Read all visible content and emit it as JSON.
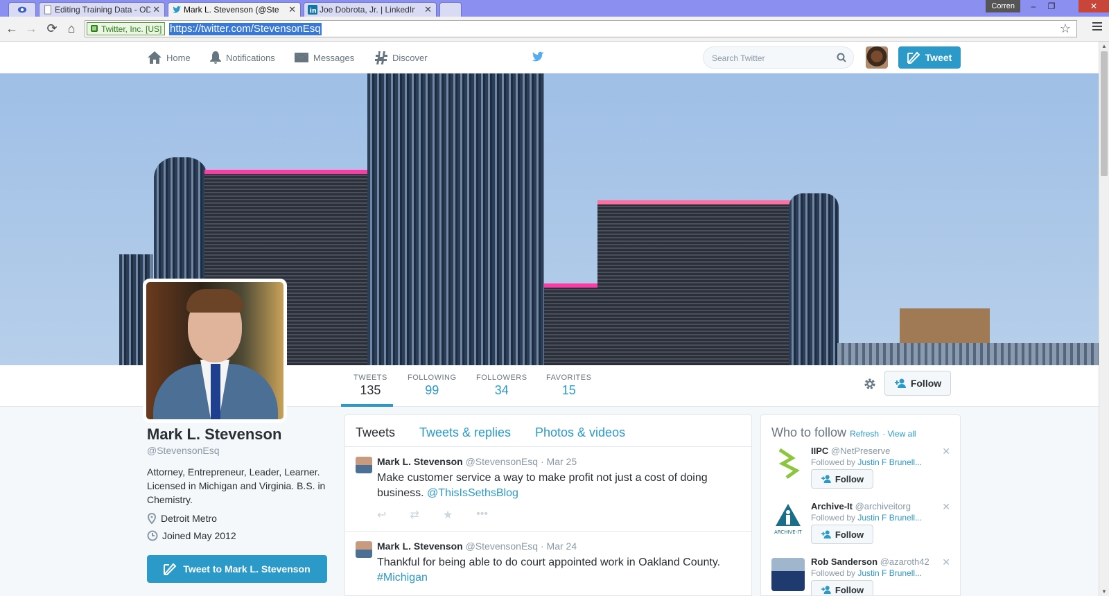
{
  "browser": {
    "tabs": [
      {
        "label": "",
        "icon": "eye-icon"
      },
      {
        "label": "Editing Training Data - OD",
        "icon": "document-icon"
      },
      {
        "label": "Mark L. Stevenson (@Stev",
        "icon": "twitter-icon"
      },
      {
        "label": "Joe Dobrota, Jr. | LinkedIn",
        "icon": "linkedin-icon"
      }
    ],
    "active_tab": 2,
    "user": "Corren",
    "ev_label": "Twitter, Inc. [US]",
    "url": "https://twitter.com/StevensonEsq"
  },
  "nav": {
    "home": "Home",
    "notifications": "Notifications",
    "messages": "Messages",
    "discover": "Discover",
    "search_placeholder": "Search Twitter",
    "tweet_button": "Tweet"
  },
  "stats": {
    "tweets_label": "TWEETS",
    "tweets": "135",
    "following_label": "FOLLOWING",
    "following": "99",
    "followers_label": "FOLLOWERS",
    "followers": "34",
    "favorites_label": "FAVORITES",
    "favorites": "15",
    "follow_button": "Follow"
  },
  "profile": {
    "name": "Mark L. Stevenson",
    "handle": "@StevensonEsq",
    "bio": "Attorney, Entrepreneur, Leader, Learner. Licensed in Michigan and Virginia. B.S. in Chemistry.",
    "location": "Detroit Metro",
    "joined": "Joined May 2012",
    "tweet_to": "Tweet to Mark L. Stevenson"
  },
  "timeline": {
    "tabs": [
      "Tweets",
      "Tweets & replies",
      "Photos & videos"
    ],
    "tweets": [
      {
        "name": "Mark L. Stevenson",
        "handle": "@StevensonEsq",
        "date": "· Mar 25",
        "text": "Make customer service a way to make profit not just a cost of doing business.",
        "link": "@ThisIsSethsBlog"
      },
      {
        "name": "Mark L. Stevenson",
        "handle": "@StevensonEsq",
        "date": "· Mar 24",
        "text": "Thankful for being able to do court appointed work in Oakland County.",
        "link": "#Michigan"
      }
    ]
  },
  "who_to_follow": {
    "title": "Who to follow",
    "refresh": "Refresh",
    "view_all": "View all",
    "followed_by_prefix": "Followed by",
    "follow_label": "Follow",
    "items": [
      {
        "name": "IIPC",
        "handle": "@NetPreserve",
        "followed_by": "Justin F Brunell..."
      },
      {
        "name": "Archive-It",
        "handle": "@archiveitorg",
        "followed_by": "Justin F Brunell..."
      },
      {
        "name": "Rob Sanderson",
        "handle": "@azaroth42",
        "followed_by": "Justin F Brunell..."
      }
    ]
  },
  "colors": {
    "twitter_blue": "#2b9ac8",
    "tab_bar": "#8a8ff0",
    "building_pink": "#ff3aa6"
  }
}
